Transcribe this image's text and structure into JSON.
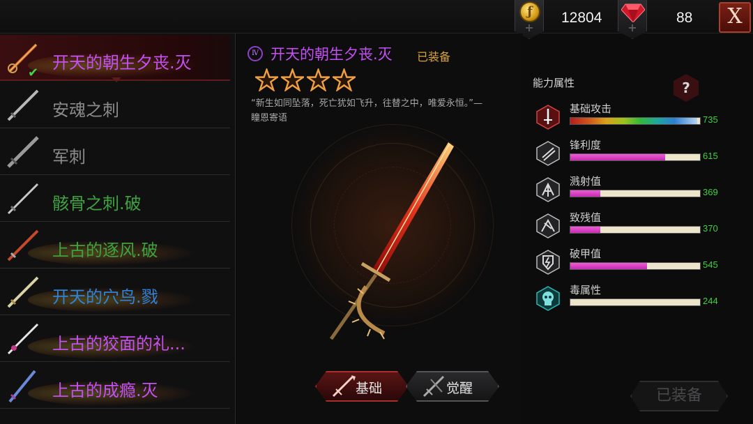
{
  "currency": {
    "gold": {
      "icon": "gold-coin-icon",
      "value": "12804"
    },
    "gems": {
      "icon": "ruby-gem-icon",
      "value": "88"
    },
    "add_symbol": "+"
  },
  "close_label": "X",
  "weapons": [
    {
      "name": "开天的朝生夕丧.灭",
      "color": "#c44ff2",
      "selected": true,
      "equipped": true
    },
    {
      "name": "安魂之刺",
      "color": "#8b8b8b"
    },
    {
      "name": "军刺",
      "color": "#8b8b8b"
    },
    {
      "name": "骸骨之刺.破",
      "color": "#3ea33e"
    },
    {
      "name": "上古的逐风.破",
      "color": "#3ea33e"
    },
    {
      "name": "开天的穴鸟.戮",
      "color": "#2f83d8"
    },
    {
      "name": "上古的狡面的礼...",
      "color": "#c44ff2"
    },
    {
      "name": "上古的成瘾.灭",
      "color": "#c44ff2"
    }
  ],
  "detail": {
    "tier": "Ⅳ",
    "title": "开天的朝生夕丧.灭",
    "equipped_label": "已装备",
    "stars": 4,
    "quote": "“新生如同坠落，死亡犹如飞升，往替之中，唯爱永恒。”—瞳恩寄语"
  },
  "tabs": [
    {
      "label": "基础",
      "icon": "basic-sword-icon",
      "active": true
    },
    {
      "label": "觉醒",
      "icon": "awaken-sword-icon",
      "active": false
    }
  ],
  "attributes": {
    "title": "能力属性",
    "help_label": "?",
    "rows": [
      {
        "name": "基础攻击",
        "icon": "base-attack-icon",
        "value": "735",
        "fraction": 0.98,
        "style": "rainbow"
      },
      {
        "name": "锋利度",
        "icon": "sharpness-icon",
        "value": "615",
        "fraction": 0.73,
        "style": "pink"
      },
      {
        "name": "溅射值",
        "icon": "splash-icon",
        "value": "369",
        "fraction": 0.23,
        "style": "pink"
      },
      {
        "name": "致残值",
        "icon": "cripple-icon",
        "value": "370",
        "fraction": 0.23,
        "style": "pink"
      },
      {
        "name": "破甲值",
        "icon": "armor-break-icon",
        "value": "545",
        "fraction": 0.59,
        "style": "pink"
      },
      {
        "name": "毒属性",
        "icon": "poison-skull-icon",
        "value": "244",
        "fraction": 0.0,
        "style": "pink"
      }
    ]
  },
  "equip_button_label": "已装备"
}
